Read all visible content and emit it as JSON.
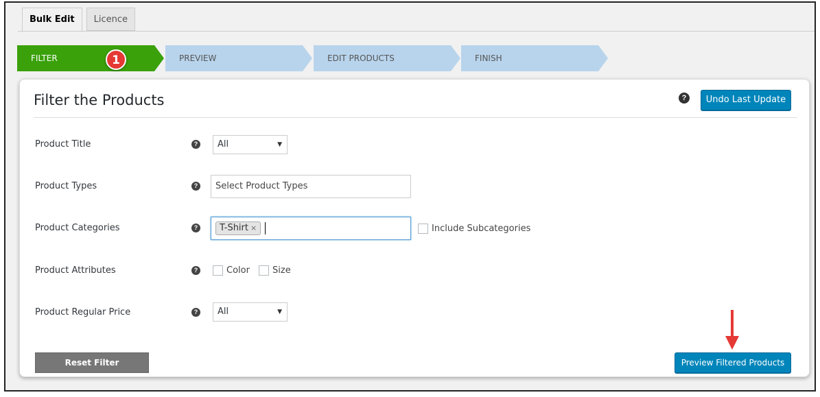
{
  "tabs": [
    {
      "label": "Bulk Edit",
      "active": true
    },
    {
      "label": "Licence",
      "active": false
    }
  ],
  "steps": [
    {
      "label": "FILTER",
      "active": true
    },
    {
      "label": "PREVIEW",
      "active": false
    },
    {
      "label": "EDIT PRODUCTS",
      "active": false
    },
    {
      "label": "FINISH",
      "active": false
    }
  ],
  "step_badge": "1",
  "panel": {
    "title": "Filter the Products",
    "undo_button": "Undo Last Update",
    "help_glyph": "?"
  },
  "fields": {
    "product_title": {
      "label": "Product Title",
      "value": "All"
    },
    "product_types": {
      "label": "Product Types",
      "placeholder": "Select Product Types"
    },
    "product_categories": {
      "label": "Product Categories",
      "chip": "T-Shirt",
      "chip_remove": "×",
      "include_subcategories": "Include Subcategories"
    },
    "product_attributes": {
      "label": "Product Attributes",
      "options": [
        "Color",
        "Size"
      ]
    },
    "product_regular_price": {
      "label": "Product Regular Price",
      "value": "All"
    }
  },
  "buttons": {
    "reset": "Reset Filter",
    "preview": "Preview Filtered Products"
  },
  "colors": {
    "active_step": "#3aa10a",
    "inactive_step": "#b8d4ec",
    "primary_button": "#0085ba",
    "badge": "#e53935",
    "annotation_arrow": "#e53935"
  }
}
